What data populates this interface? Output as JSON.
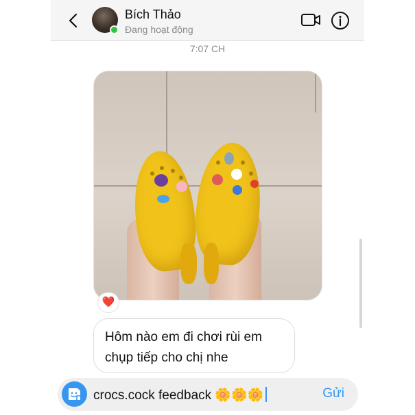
{
  "header": {
    "name": "Bích Thảo",
    "status": "Đang hoạt động",
    "back_icon": "chevron-left-icon",
    "video_icon": "video-call-icon",
    "info_icon": "info-icon",
    "online_color": "#31c24a"
  },
  "thread": {
    "timestamp": "7:07 CH",
    "reaction": "❤️",
    "message": "Hôm nào em đi chơi rùi em chụp tiếp cho chị nhe"
  },
  "composer": {
    "draft_text": "crocs.cock feedback 🌼🌼🌼",
    "send_label": "Gửi",
    "sticker_icon": "sticker-icon",
    "accent_color": "#3797f0"
  }
}
